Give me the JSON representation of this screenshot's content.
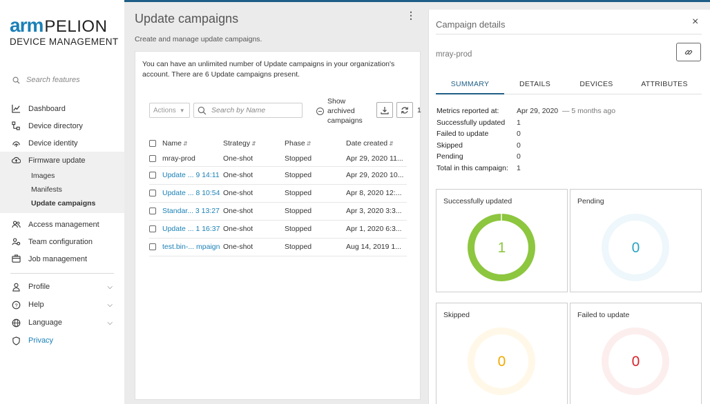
{
  "sidebar": {
    "logo_arm": "arm",
    "logo_pelion": "PELION",
    "logo_sub": "DEVICE MANAGEMENT",
    "search_placeholder": "Search features",
    "items": [
      {
        "label": "Dashboard",
        "icon": "chart-icon"
      },
      {
        "label": "Device directory",
        "icon": "device-directory-icon"
      },
      {
        "label": "Device identity",
        "icon": "fingerprint-icon"
      },
      {
        "label": "Firmware update",
        "icon": "cloud-upload-icon"
      }
    ],
    "firmware_sub": [
      "Images",
      "Manifests",
      "Update campaigns"
    ],
    "items2": [
      {
        "label": "Access management",
        "icon": "users-icon"
      },
      {
        "label": "Team configuration",
        "icon": "team-gear-icon"
      },
      {
        "label": "Job management",
        "icon": "job-icon"
      }
    ],
    "bottom": [
      {
        "label": "Profile",
        "icon": "person-icon"
      },
      {
        "label": "Help",
        "icon": "help-icon"
      },
      {
        "label": "Language",
        "icon": "globe-icon"
      },
      {
        "label": "Privacy",
        "icon": "shield-icon"
      }
    ]
  },
  "main": {
    "title": "Update campaigns",
    "subtitle": "Create and manage update campaigns.",
    "description": "You can have an unlimited number of Update campaigns in your organization's account. There are 6 Update campaigns present.",
    "actions_label": "Actions",
    "search_placeholder": "Search by Name",
    "show_archived": "Show archived campaigns",
    "page_count": "1",
    "columns": [
      "Name",
      "Strategy",
      "Phase",
      "Date created"
    ],
    "rows": [
      {
        "name": "mray-prod",
        "strategy": "One-shot",
        "phase": "Stopped",
        "date": "Apr 29, 2020 11...",
        "link": false
      },
      {
        "name": "Update ... 9 14:11",
        "strategy": "One-shot",
        "phase": "Stopped",
        "date": "Apr 29, 2020 10...",
        "link": true
      },
      {
        "name": "Update ... 8 10:54",
        "strategy": "One-shot",
        "phase": "Stopped",
        "date": "Apr 8, 2020 12:...",
        "link": true
      },
      {
        "name": "Standar... 3 13:27",
        "strategy": "One-shot",
        "phase": "Stopped",
        "date": "Apr 3, 2020 3:3...",
        "link": true
      },
      {
        "name": "Update ... 1 16:37",
        "strategy": "One-shot",
        "phase": "Stopped",
        "date": "Apr 1, 2020 6:3...",
        "link": true
      },
      {
        "name": "test.bin-... mpaign",
        "strategy": "One-shot",
        "phase": "Stopped",
        "date": "Aug 14, 2019 1...",
        "link": true
      }
    ]
  },
  "panel": {
    "title": "Campaign details",
    "close": "×",
    "campaign_name": "mray-prod",
    "tabs": [
      "SUMMARY",
      "DETAILS",
      "DEVICES",
      "ATTRIBUTES"
    ],
    "metrics": [
      {
        "k": "Metrics reported at:",
        "v": "Apr 29, 2020",
        "extra": "— 5 months ago"
      },
      {
        "k": "Successfully updated",
        "v": "1"
      },
      {
        "k": "Failed to update",
        "v": "0"
      },
      {
        "k": "Skipped",
        "v": "0"
      },
      {
        "k": "Pending",
        "v": "0"
      },
      {
        "k": "Total in this campaign:",
        "v": "1"
      }
    ],
    "stats": [
      {
        "label": "Successfully updated",
        "value": "1",
        "color": "#8dc63f",
        "track": "#8dc63f",
        "num_color": "#8dc63f"
      },
      {
        "label": "Pending",
        "value": "0",
        "color": "#f0f8fc",
        "track": "#eef7fb",
        "num_color": "#2aa3c4"
      },
      {
        "label": "Skipped",
        "value": "0",
        "color": "#fff8e8",
        "track": "#fff8e8",
        "num_color": "#f2a900"
      },
      {
        "label": "Failed to update",
        "value": "0",
        "color": "#fdeeee",
        "track": "#fdeeee",
        "num_color": "#d9232a"
      }
    ]
  }
}
